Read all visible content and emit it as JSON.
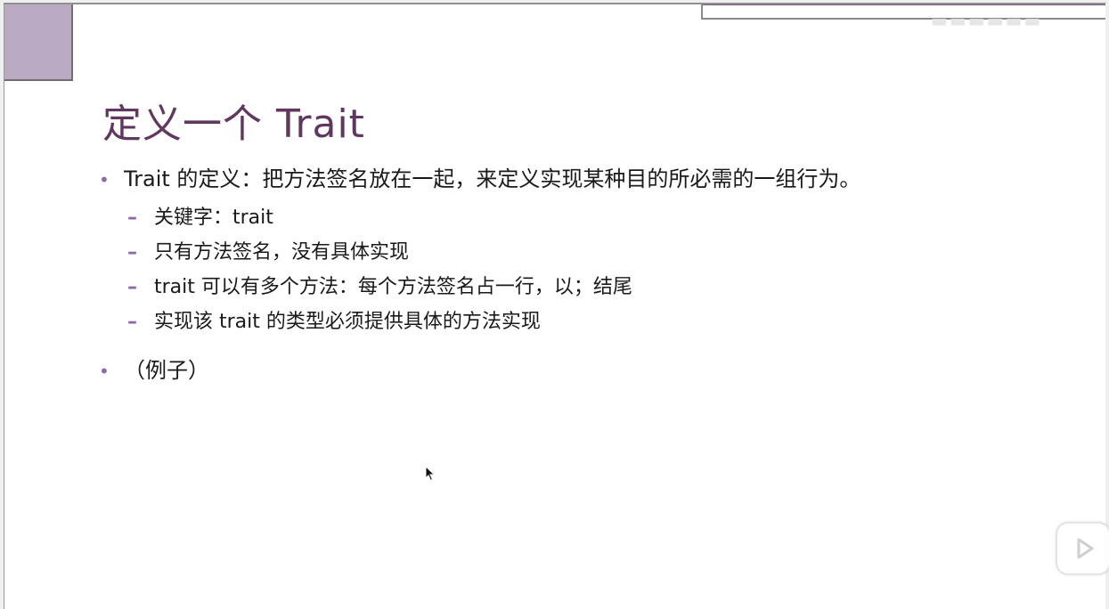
{
  "slide": {
    "title": "定义一个 Trait",
    "bullets": [
      {
        "text": "Trait 的定义：把方法签名放在一起，来定义实现某种目的所必需的一组行为。",
        "subitems": [
          "关键字：trait",
          "只有方法签名，没有具体实现",
          "trait 可以有多个方法：每个方法签名占一行，以；结尾",
          "实现该 trait 的类型必须提供具体的方法实现"
        ]
      },
      {
        "text": "（例子）"
      }
    ],
    "bullet_mark": "•",
    "sub_mark": "–"
  },
  "colors": {
    "title": "#60385f",
    "accent": "#8b6aa6",
    "corner_block": "#b9a9c2"
  },
  "icons": {
    "cursor": "mouse-pointer-icon",
    "player": "play-icon"
  }
}
